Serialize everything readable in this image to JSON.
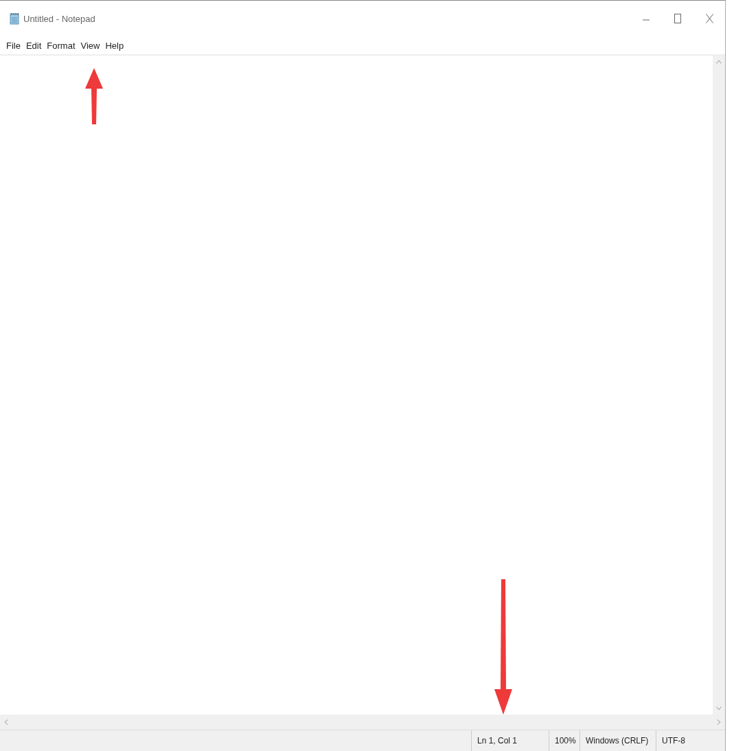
{
  "window": {
    "title": "Untitled - Notepad"
  },
  "menu": [
    "File",
    "Edit",
    "Format",
    "View",
    "Help"
  ],
  "status_bar": [
    "Ln 1, Col 1",
    "100%",
    "Windows (CRLF)",
    "UTF-8"
  ],
  "annotations": [
    {
      "kind": "arrow-up"
    },
    {
      "kind": "arrow-down"
    }
  ]
}
